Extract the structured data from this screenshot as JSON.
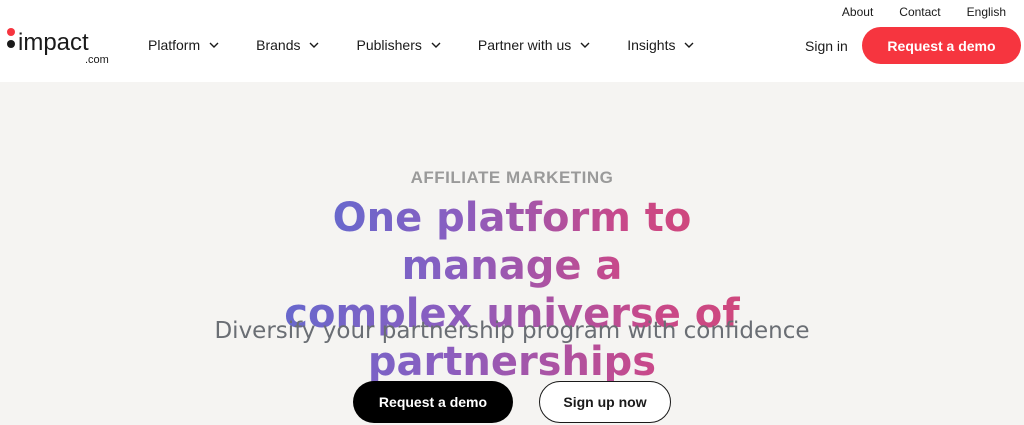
{
  "brand": {
    "logo_text": "impact",
    "logo_subtext": ".com",
    "accent_color": "#f6353f"
  },
  "utility_nav": {
    "about": "About",
    "contact": "Contact",
    "language": "English"
  },
  "nav": {
    "items": [
      {
        "label": "Platform",
        "icon": "chevron-down-icon"
      },
      {
        "label": "Brands",
        "icon": "chevron-down-icon"
      },
      {
        "label": "Publishers",
        "icon": "chevron-down-icon"
      },
      {
        "label": "Partner with us",
        "icon": "chevron-down-icon"
      },
      {
        "label": "Insights",
        "icon": "chevron-down-icon"
      }
    ],
    "sign_in": "Sign in",
    "cta": "Request a demo"
  },
  "hero": {
    "eyebrow": "AFFILIATE MARKETING",
    "headline_line1": "One platform to manage a",
    "headline_line2": "complex universe of partnerships",
    "subheadline": "Diversify your partnership program with confidence",
    "primary_cta": "Request a demo",
    "secondary_cta": "Sign up now",
    "gradient_colors": [
      "#4f6fd6",
      "#8a5ec0",
      "#c8498a",
      "#d8466d"
    ],
    "background": "#f5f4f2"
  }
}
